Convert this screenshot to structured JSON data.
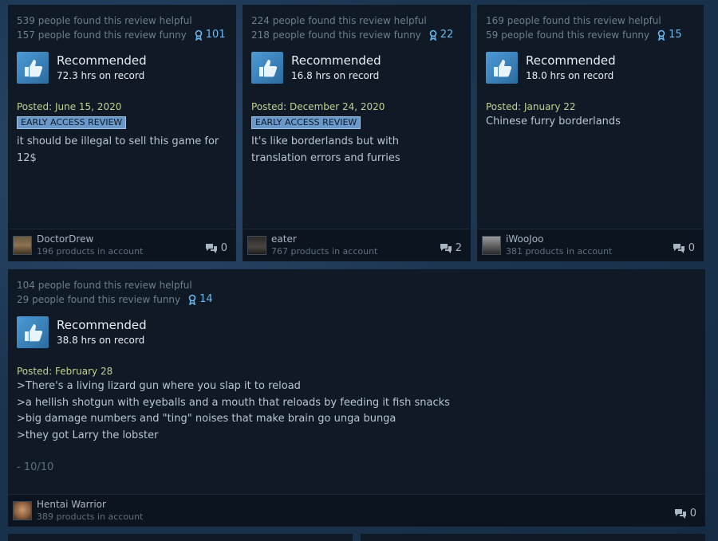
{
  "reviews": [
    {
      "helpful": "539 people found this review helpful",
      "funny": "157 people found this review funny",
      "awards": "101",
      "verdict": "Recommended",
      "hours": "72.3 hrs on record",
      "posted": "Posted: June 15, 2020",
      "badge": "EARLY ACCESS REVIEW",
      "lines": [
        "it should be illegal to sell this game for 12$"
      ],
      "author": "DoctorDrew",
      "products": "196 products in account",
      "comments": "0"
    },
    {
      "helpful": "224 people found this review helpful",
      "funny": "218 people found this review funny",
      "awards": "22",
      "verdict": "Recommended",
      "hours": "16.8 hrs on record",
      "posted": "Posted: December 24, 2020",
      "badge": "EARLY ACCESS REVIEW",
      "lines": [
        "It's like borderlands but with translation errors and furries"
      ],
      "author": "eater",
      "products": "767 products in account",
      "comments": "2"
    },
    {
      "helpful": "169 people found this review helpful",
      "funny": "59 people found this review funny",
      "awards": "15",
      "verdict": "Recommended",
      "hours": "18.0 hrs on record",
      "posted": "Posted: January 22",
      "badge": "",
      "lines": [
        "Chinese furry borderlands"
      ],
      "author": "iWooJoo",
      "products": "381 products in account",
      "comments": "0"
    },
    {
      "helpful": "104 people found this review helpful",
      "funny": "29 people found this review funny",
      "awards": "14",
      "verdict": "Recommended",
      "hours": "38.8 hrs on record",
      "posted": "Posted: February 28",
      "badge": "",
      "lines": [
        ">There's a living lizard gun where you slap it to reload",
        ">a hellish shotgun with eyeballs and a mouth that reloads by feeding it fish snacks",
        ">big damage numbers and \"ting\" noises that make brain go unga bunga",
        ">they got Larry the lobster",
        "",
        "- 10/10"
      ],
      "author": "Hentai Warrior",
      "products": "389 products in account",
      "comments": "0"
    }
  ],
  "icons": {
    "thumb": "thumbs-up-icon",
    "award": "award-ribbon-icon",
    "comment": "comment-bubble-icon"
  },
  "colors": {
    "card_bg": "#101a27",
    "accent": "#6ab8ef",
    "badge": "#6a98c9"
  }
}
